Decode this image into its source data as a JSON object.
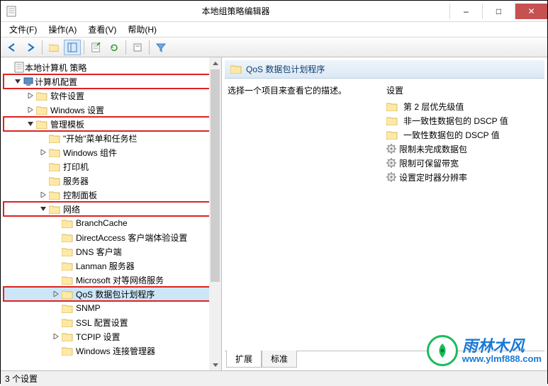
{
  "window": {
    "title": "本地组策略编辑器",
    "min": "–",
    "max": "□",
    "close": "✕"
  },
  "menu": {
    "file": "文件(F)",
    "action": "操作(A)",
    "view": "查看(V)",
    "help": "帮助(H)"
  },
  "tree": {
    "root": "本地计算机 策略",
    "computer_config": "计算机配置",
    "software_settings": "软件设置",
    "windows_settings": "Windows 设置",
    "admin_templates": "管理模板",
    "start_taskbar": "\"开始\"菜单和任务栏",
    "windows_components": "Windows 组件",
    "printers": "打印机",
    "servers": "服务器",
    "control_panel": "控制面板",
    "network": "网络",
    "branchcache": "BranchCache",
    "directaccess": "DirectAccess 客户端体验设置",
    "dns_client": "DNS 客户端",
    "lanman": "Lanman 服务器",
    "ms_p2p": "Microsoft 对等网络服务",
    "qos": "QoS 数据包计划程序",
    "snmp": "SNMP",
    "ssl": "SSL 配置设置",
    "tcpip": "TCPIP 设置",
    "wcm": "Windows 连接管理器"
  },
  "details": {
    "header": "QoS 数据包计划程序",
    "prompt": "选择一个项目来查看它的描述。",
    "settings_label": "设置",
    "items": [
      {
        "type": "folder",
        "label": "第 2 层优先级值"
      },
      {
        "type": "folder",
        "label": "非一致性数据包的 DSCP 值"
      },
      {
        "type": "folder",
        "label": "一致性数据包的 DSCP 值"
      },
      {
        "type": "setting",
        "label": "限制未完成数据包"
      },
      {
        "type": "setting",
        "label": "限制可保留带宽"
      },
      {
        "type": "setting",
        "label": "设置定时器分辨率"
      }
    ]
  },
  "tabs": {
    "extended": "扩展",
    "standard": "标准"
  },
  "status": "3 个设置",
  "watermark": {
    "cn": "雨林木风",
    "url": "www.ylmf888.com"
  }
}
